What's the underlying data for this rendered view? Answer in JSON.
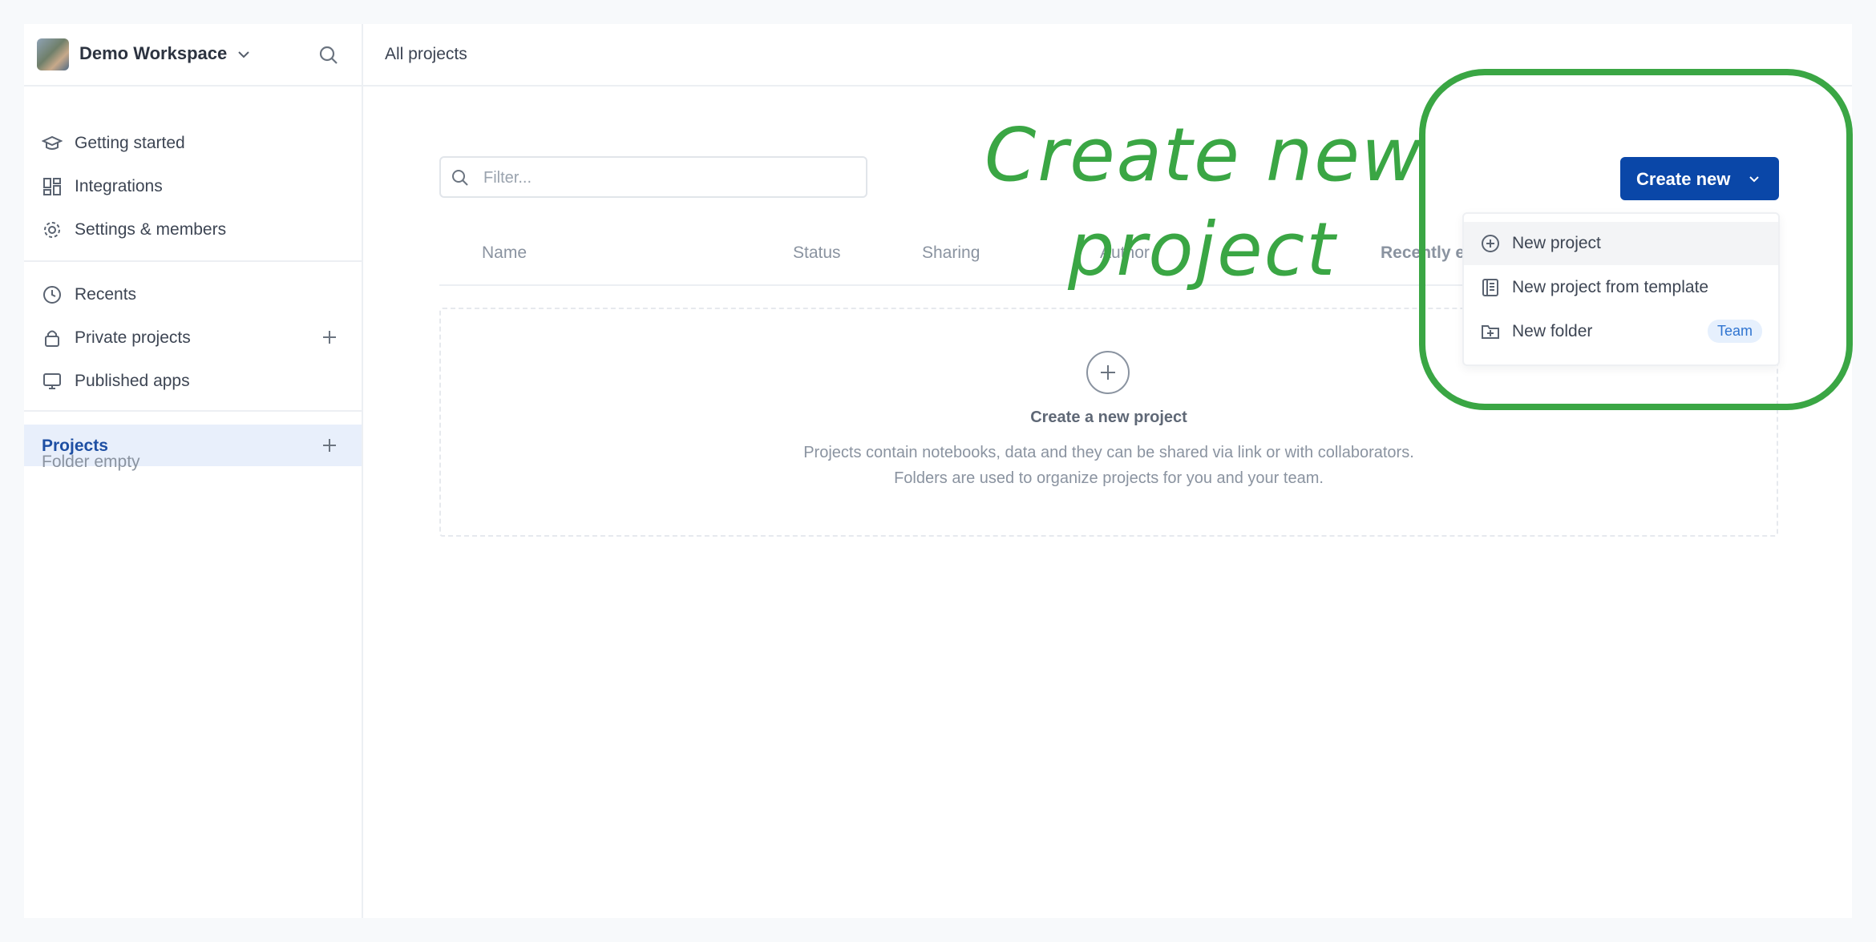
{
  "sidebar": {
    "workspace_name": "Demo Workspace",
    "nav_top": [
      {
        "label": "Getting started",
        "icon": "graduation-cap-icon"
      },
      {
        "label": "Integrations",
        "icon": "grid-icon"
      },
      {
        "label": "Settings & members",
        "icon": "gear-icon"
      }
    ],
    "nav_mid": [
      {
        "label": "Recents",
        "icon": "clock-icon"
      },
      {
        "label": "Private projects",
        "icon": "lock-icon"
      },
      {
        "label": "Published apps",
        "icon": "monitor-icon"
      }
    ],
    "projects_label": "Projects",
    "folder_empty": "Folder empty"
  },
  "topbar": {
    "title": "All projects"
  },
  "filter": {
    "placeholder": "Filter..."
  },
  "table": {
    "columns": [
      "Name",
      "Status",
      "Sharing",
      "Author",
      "Recently e"
    ]
  },
  "empty_state": {
    "title": "Create a new project",
    "line1": "Projects contain notebooks, data and they can be shared via link or with collaborators.",
    "line2": "Folders are used to organize projects for you and your team."
  },
  "create_button": {
    "label": "Create new"
  },
  "menu": {
    "items": [
      {
        "label": "New project",
        "icon": "plus-circle-icon"
      },
      {
        "label": "New project from template",
        "icon": "template-icon"
      },
      {
        "label": "New folder",
        "icon": "folder-plus-icon",
        "badge": "Team"
      }
    ]
  },
  "annotation": {
    "line1": "Create new",
    "line2": "project"
  },
  "colors": {
    "accent": "#0a47a8",
    "annotation": "#3aa644",
    "badge_bg": "#e6f0fd"
  }
}
